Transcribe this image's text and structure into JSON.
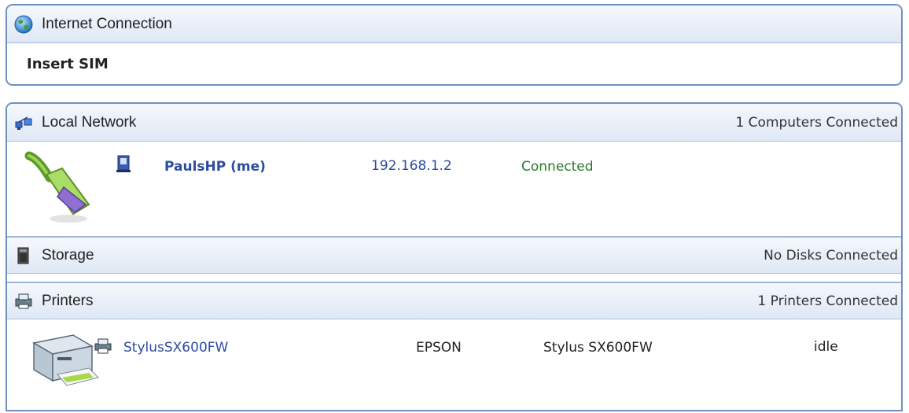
{
  "internet": {
    "title": "Internet Connection",
    "status": "Insert SIM",
    "icon": "globe-icon"
  },
  "local_network": {
    "title": "Local Network",
    "count": "1 Computers Connected",
    "icon": "network-icon",
    "image": "ethernet-cable-icon",
    "computers": [
      {
        "name": "PaulsHP (me)",
        "ip": "192.168.1.2",
        "status": "Connected",
        "icon": "computer-icon"
      }
    ]
  },
  "storage": {
    "title": "Storage",
    "count": "No Disks Connected",
    "icon": "storage-icon"
  },
  "printers": {
    "title": "Printers",
    "count": "1 Printers Connected",
    "icon": "printer-icon",
    "image": "printer-large-icon",
    "list": [
      {
        "name": "StylusSX600FW",
        "manufacturer": "EPSON",
        "model": "Stylus SX600FW",
        "status": "idle",
        "icon": "printer-small-icon"
      }
    ]
  },
  "colors": {
    "border": "#6f8fbf",
    "header_gradient_top": "#f5f8fd",
    "header_gradient_bottom": "#dfe8f5",
    "link": "#2b4da0",
    "connected": "#2a7a2a"
  }
}
